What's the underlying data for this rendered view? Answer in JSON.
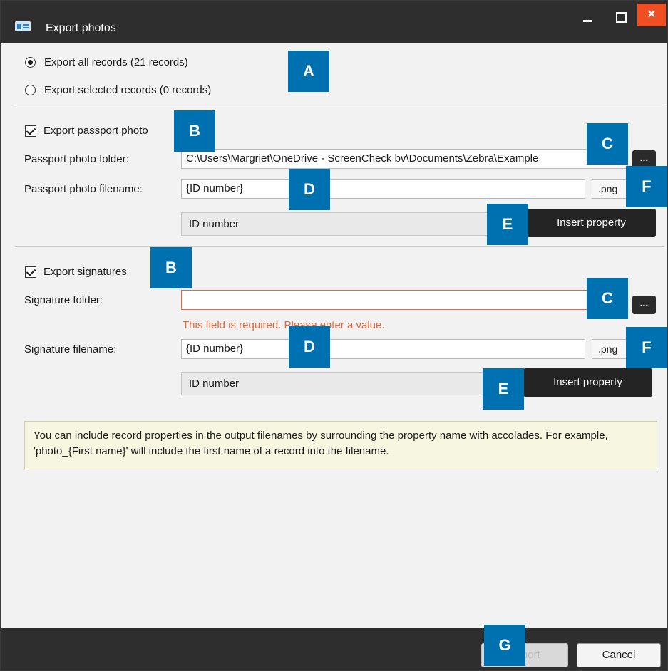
{
  "window": {
    "title": "Export photos",
    "controls": {
      "minimize": "minimize",
      "maximize": "maximize",
      "close": "×"
    }
  },
  "export_scope": {
    "all_label": "Export all records (21 records)",
    "selected_label": "Export selected records (0 records)",
    "selected": "all"
  },
  "passport": {
    "checkbox_label": "Export passport photo",
    "checked": true,
    "folder_label": "Passport photo folder:",
    "folder_value": "C:\\Users\\Margriet\\OneDrive - ScreenCheck bv\\Documents\\Zebra\\Example",
    "browse_label": "...",
    "filename_label": "Passport photo filename:",
    "filename_value": "{ID number}",
    "extension": ".png",
    "property_select": "ID number",
    "insert_label": "Insert property"
  },
  "signatures": {
    "checkbox_label": "Export signatures",
    "checked": true,
    "folder_label": "Signature folder:",
    "folder_value": "",
    "browse_label": "...",
    "error_text": "This field is required. Please enter a value.",
    "filename_label": "Signature filename:",
    "filename_value": "{ID number}",
    "extension": ".png",
    "property_select": "ID number",
    "insert_label": "Insert property"
  },
  "info_text": "You can include record properties in the output filenames by surrounding the property name with accolades. For example, 'photo_{First name}' will include the first name of a record into the filename.",
  "footer": {
    "export_label": "Export",
    "export_enabled": false,
    "cancel_label": "Cancel"
  },
  "markers": {
    "a": "A",
    "b1": "B",
    "b2": "B",
    "c1": "C",
    "c2": "C",
    "d1": "D",
    "d2": "D",
    "e1": "E",
    "e2": "E",
    "f1": "F",
    "f2": "F",
    "g": "G"
  },
  "colors": {
    "titlebar": "#2e2e2e",
    "close_button": "#f04e23",
    "marker": "#0071b0",
    "error": "#e8663c",
    "info_background": "#f7f7e1"
  }
}
